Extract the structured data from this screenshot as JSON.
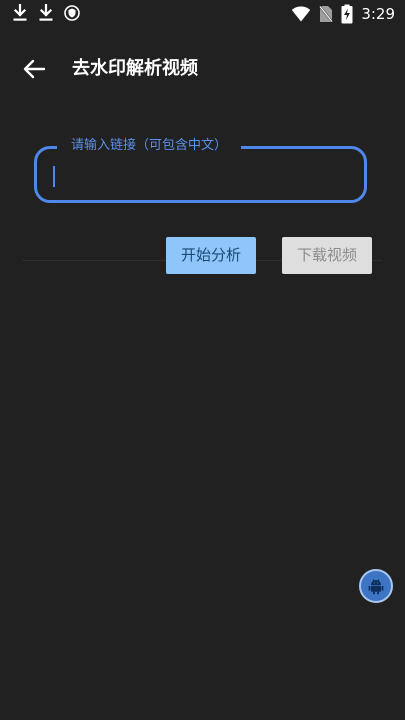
{
  "status_bar": {
    "time": "3:29",
    "icons": [
      "download-icon",
      "download-icon",
      "shield-icon",
      "wifi-icon",
      "no-sim-icon",
      "battery-charging-icon"
    ]
  },
  "app_bar": {
    "title": "去水印解析视频",
    "back_icon": "arrow-left-icon"
  },
  "link_input": {
    "label": "请输入链接（可包含中文）",
    "value": ""
  },
  "actions": {
    "analyze_label": "开始分析",
    "download_label": "下载视频"
  },
  "floating_button": {
    "icon": "android-icon"
  },
  "colors": {
    "background": "#212121",
    "accent": "#4f88ea",
    "analyze_button": "#8ec6fb",
    "download_button_disabled": "#dedede",
    "fab": "#3d74c3"
  }
}
